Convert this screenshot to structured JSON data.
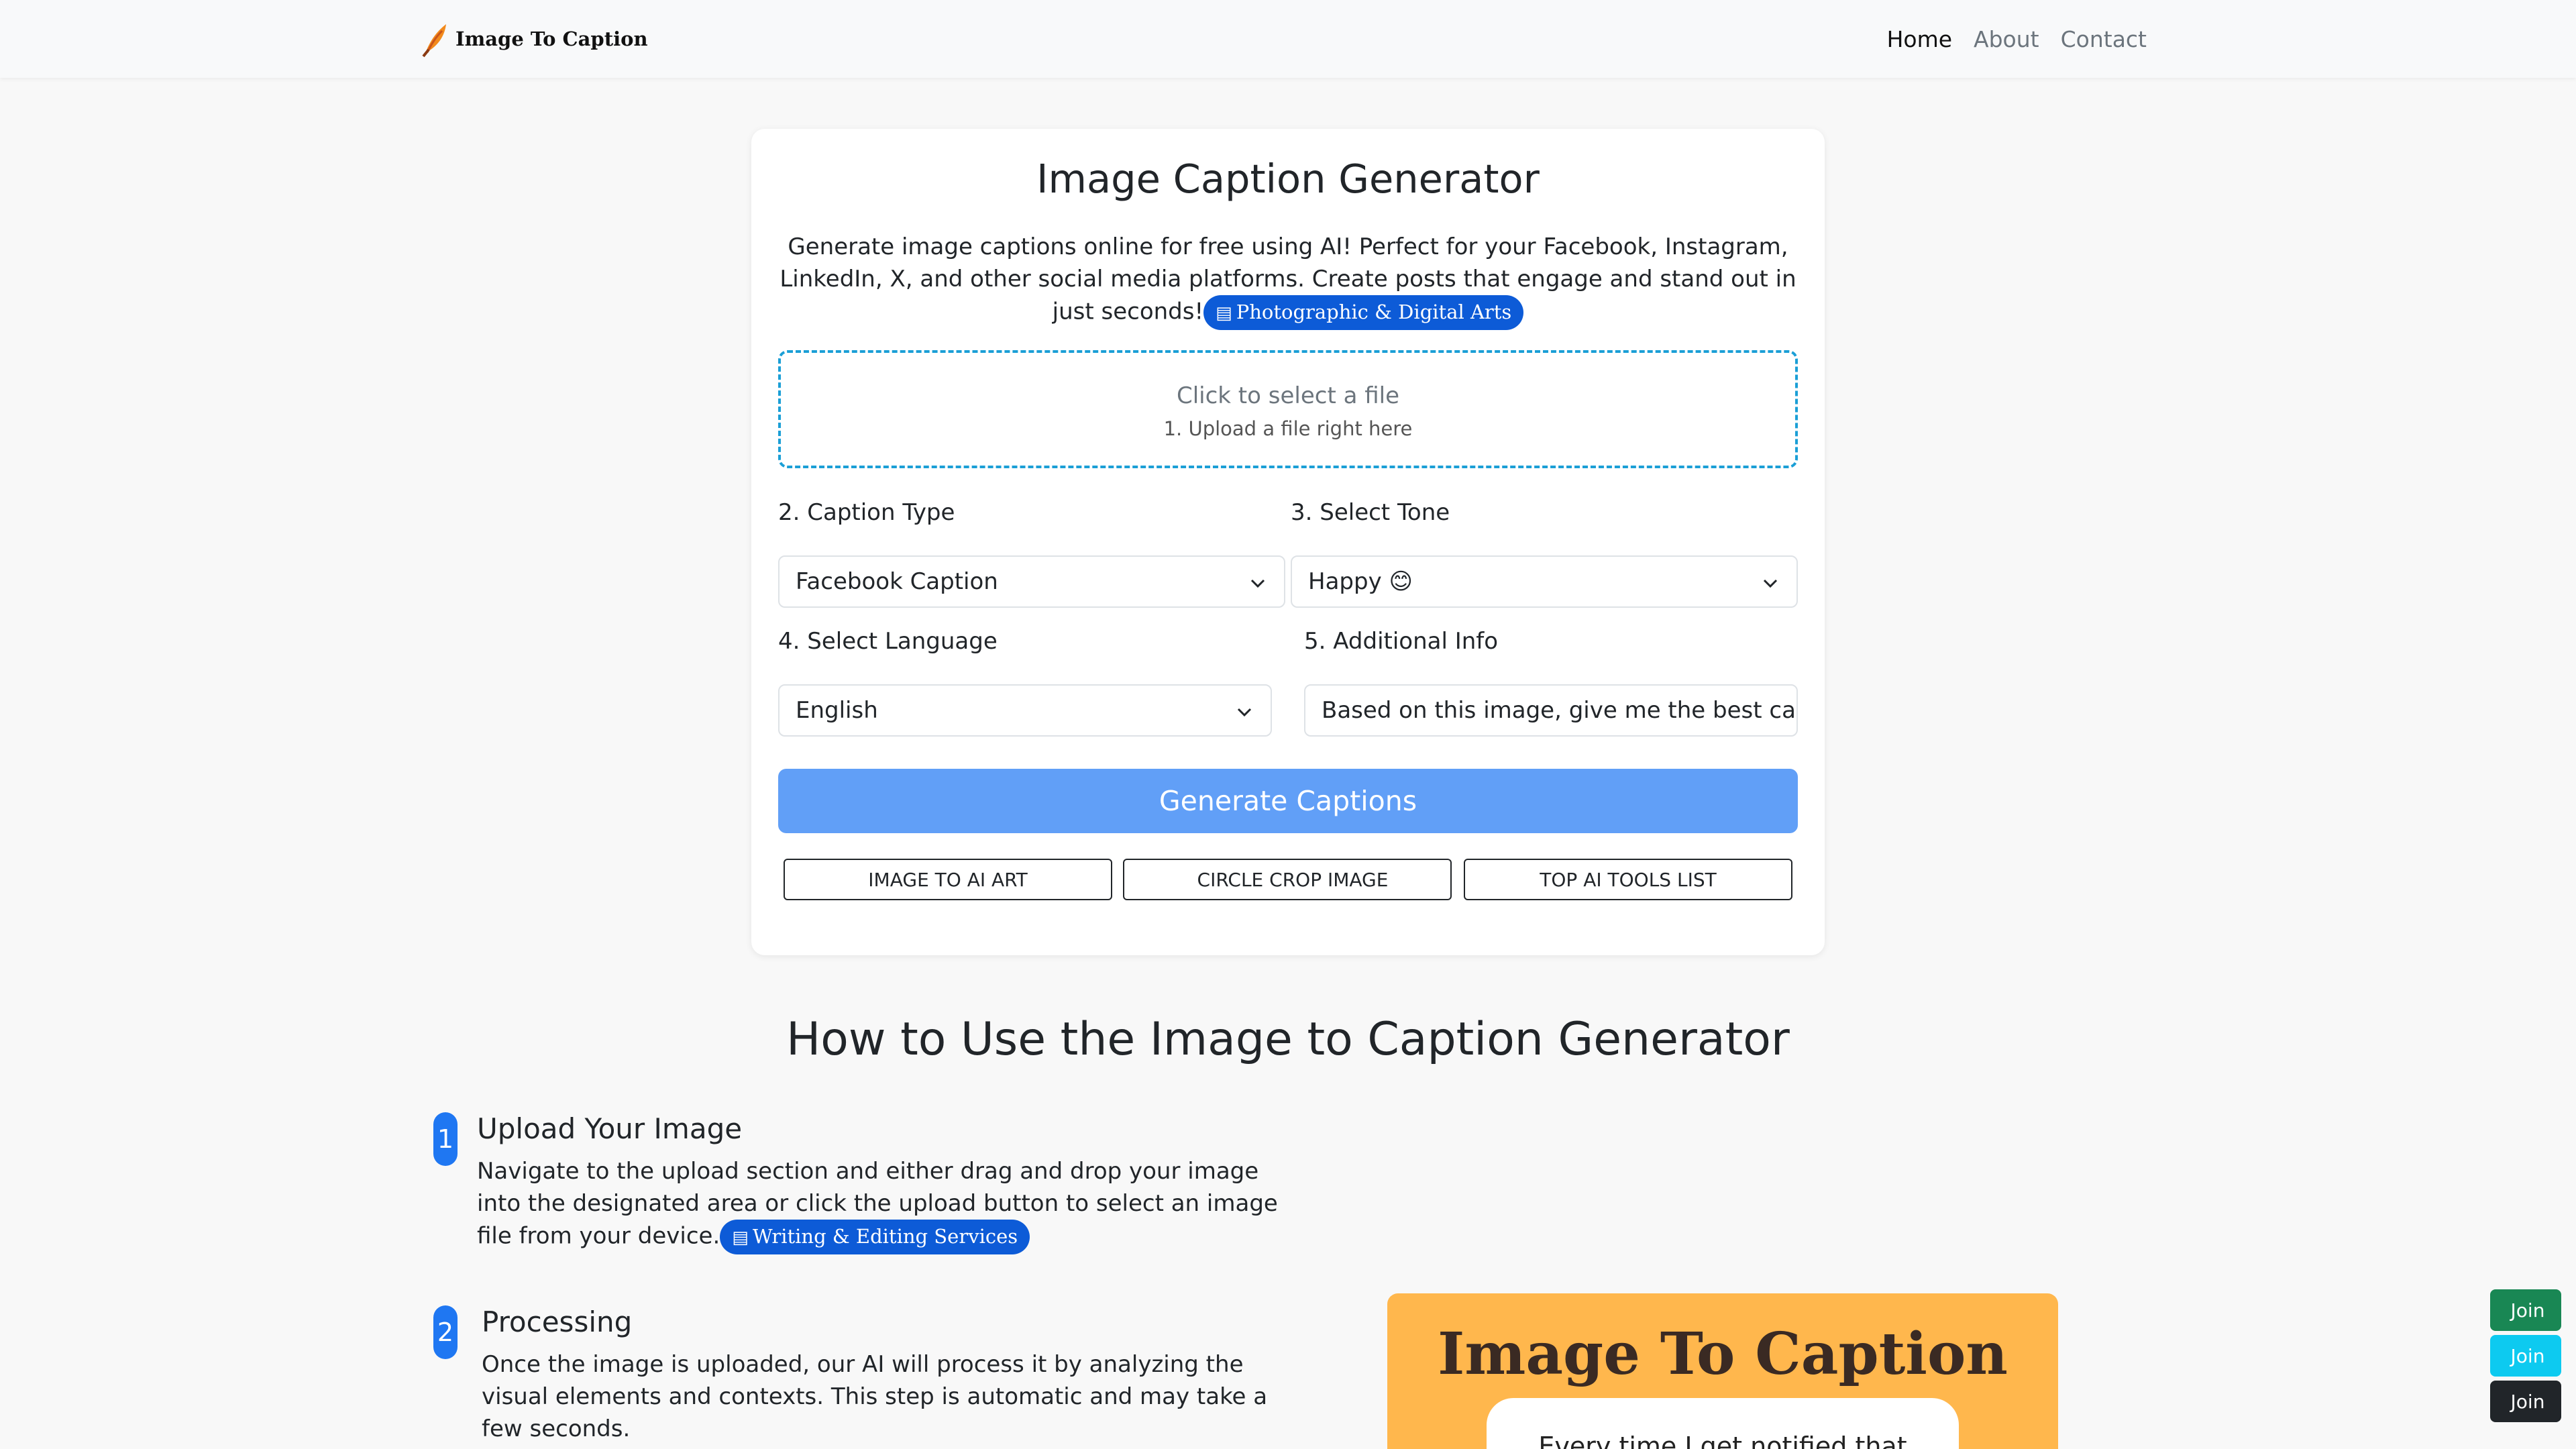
{
  "nav": {
    "brand": "Image To Caption",
    "links": [
      "Home",
      "About",
      "Contact"
    ]
  },
  "card": {
    "title": "Image Caption Generator",
    "description": "Generate image captions online for free using AI! Perfect for your Facebook, Instagram, LinkedIn, X, and other social media platforms. Create posts that engage and stand out in just seconds!",
    "category_pill": "Photographic & Digital Arts",
    "upload": {
      "main": "Click to select a file",
      "sub": "1. Upload a file right here"
    },
    "caption_type": {
      "label": "2. Caption Type",
      "value": "Facebook Caption"
    },
    "tone": {
      "label": "3. Select Tone",
      "value": "Happy 😊"
    },
    "language": {
      "label": "4. Select Language",
      "value": "English"
    },
    "additional_info": {
      "label": "5. Additional Info",
      "value": "Based on this image, give me the best caption"
    },
    "generate_label": "Generate Captions",
    "tools": [
      "IMAGE TO AI ART",
      "CIRCLE CROP IMAGE",
      "TOP AI TOOLS LIST"
    ],
    "tool_icon": "",
    "pill_icon": "▤"
  },
  "howto": {
    "title": "How to Use the Image to Caption Generator",
    "steps": [
      {
        "number": "1",
        "title": "Upload Your Image",
        "text": "Navigate to the upload section and either drag and drop your image into the designated area or click the upload button to select an image file from your device.",
        "pill": "Writing & Editing Services"
      },
      {
        "number": "2",
        "title": "Processing",
        "text": "Once the image is uploaded, our AI will process it by analyzing the visual elements and contexts. This step is automatic and may take a few seconds."
      }
    ]
  },
  "promo": {
    "title": "Image To Caption",
    "bubble_text": "Every time I get notified that"
  },
  "join_buttons": [
    {
      "label": "Join",
      "color": "#198754"
    },
    {
      "label": "Join",
      "color": "#0dcaf0"
    },
    {
      "label": "Join",
      "color": "#212529"
    }
  ],
  "join_icon": "",
  "colors": {
    "primary_pill": "#0d5bd7",
    "generate": "#619ff7",
    "upload_border": "#1b9fd6",
    "step_badge": "#1f77f2",
    "promo_bg": "#ffb74d"
  }
}
